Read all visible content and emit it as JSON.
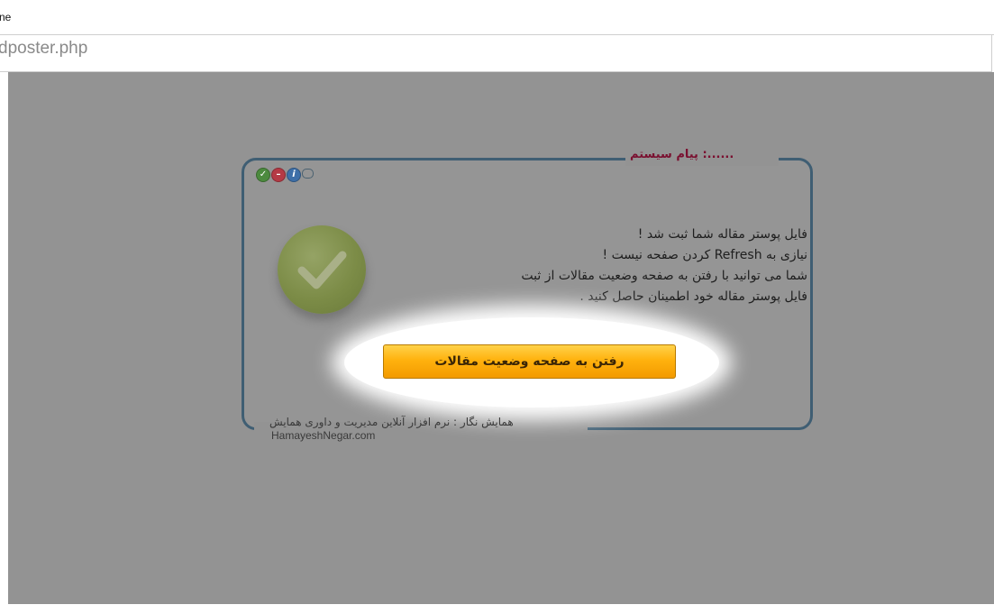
{
  "browser": {
    "title_fragment": "ne",
    "address_fragment": "dposter.php"
  },
  "dialog": {
    "title": "......: پیام سیستم",
    "message_lines": [
      "فایل پوستر مقاله شما ثبت شد !",
      "نیازی به Refresh کردن صفحه نیست !",
      "شما می توانید با رفتن به صفحه وضعیت مقالات از ثبت",
      "فایل پوستر مقاله خود اطمینان حاصل کنید ."
    ],
    "button_label": "رفتن به صفحه وضعیت مقالات",
    "footer_caption": "همایش نگار : نرم افزار آنلاین مدیریت و داوری همایش",
    "footer_site": "HamayeshNegar.com",
    "icons": [
      "check-icon",
      "close-icon",
      "info-icon",
      "chat-bubble-icon"
    ]
  },
  "colors": {
    "overlay": "#939393",
    "frame": "#3f5e73",
    "title": "#7a1030",
    "button": "#ffb20e",
    "check_badge": "#7c8c47"
  }
}
